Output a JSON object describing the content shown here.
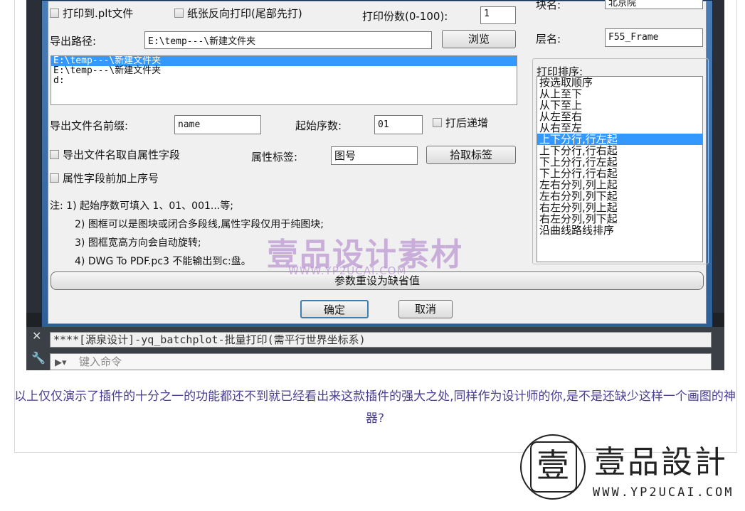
{
  "dialog": {
    "print_to_plt": "打印到.plt文件",
    "reverse_print": "纸张反向打印(尾部先打)",
    "copies_label": "打印份数(0-100):",
    "copies_value": "1",
    "block_name_label": "块名:",
    "block_name_value": "北京院",
    "export_path_label": "导出路径:",
    "export_path_value": "E:\\temp---\\新建文件夹",
    "browse_button": "浏览",
    "layer_label": "层名:",
    "layer_value": "F55_Frame",
    "path_list": [
      "E:\\temp---\\新建文件夹",
      "E:\\temp---\\新建文件夹",
      "d:"
    ],
    "path_list_selected": 0,
    "print_order_label": "打印排序:",
    "print_order_list": [
      "按选取顺序",
      "从上至下",
      "从下至上",
      "从左至右",
      "从右至左",
      "上下分行,行左起",
      "上下分行,行右起",
      "下上分行,行左起",
      "下上分行,行右起",
      "左右分列,列上起",
      "左右分列,列下起",
      "右左分列,列上起",
      "右左分列,列下起",
      "沿曲线路线排序"
    ],
    "print_order_selected": 5,
    "prefix_label": "导出文件名前缀:",
    "prefix_value": "name",
    "start_num_label": "起始序数:",
    "start_num_value": "01",
    "increment_label": "打后递增",
    "attr_name_label": "导出文件名取自属性字段",
    "attr_tag_label": "属性标签:",
    "attr_tag_value": "图号",
    "pick_tag_button": "拾取标签",
    "attr_prefix_label": "属性字段前加上序号",
    "notes": [
      "注: 1) 起始序数可填入 1、01、001...等;",
      "2) 图框可以是图块或闭合多段线,属性字段仅用于纯图块;",
      "3) 图框宽高方向会自动旋转;",
      "4) DWG To PDF.pc3 不能输出到c:盘。"
    ],
    "reset_button": "参数重设为缺省值",
    "ok_button": "确定",
    "cancel_button": "取消"
  },
  "command": {
    "history": "****[源泉设计]-yq_batchplot-批量打印(需平行世界坐标系)",
    "prompt_placeholder": "键入命令"
  },
  "watermark": {
    "text": "壹品设计素材",
    "url": "WWW.YP2UCAI.COM"
  },
  "caption": "以上仅仅演示了插件的十分之一的功能都还不到就已经看出来这款插件的强大之处,同样作为设计师的你,是不是还缺少这样一个画图的神器?",
  "logo": {
    "glyph": "壹",
    "name": "壹品設計",
    "url": "WWW.YP2UCAI.COM"
  }
}
